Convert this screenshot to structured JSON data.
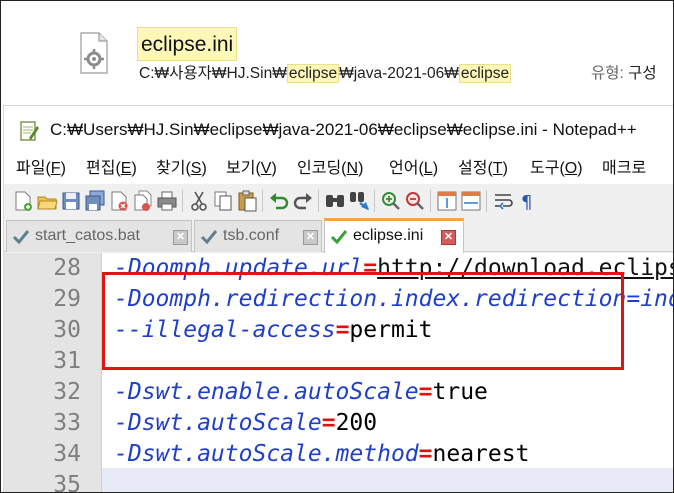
{
  "search_result": {
    "file_name": "eclipse.ini",
    "path_parts": [
      {
        "text": "C:₩사용자₩HJ.Sin₩",
        "hl": false
      },
      {
        "text": "eclipse",
        "hl": true
      },
      {
        "text": "₩java-2021-06₩",
        "hl": false
      },
      {
        "text": "eclipse",
        "hl": true
      }
    ],
    "type_label": "유형:",
    "type_value": "구성"
  },
  "window": {
    "title": "C:₩Users₩HJ.Sin₩eclipse₩java-2021-06₩eclipse₩eclipse.ini - Notepad++"
  },
  "menu": [
    {
      "label": "파일(",
      "key": "F",
      "tail": ")"
    },
    {
      "label": "편집(",
      "key": "E",
      "tail": ")"
    },
    {
      "label": "찾기(",
      "key": "S",
      "tail": ")"
    },
    {
      "label": "보기(",
      "key": "V",
      "tail": ")"
    },
    {
      "label": "인코딩(",
      "key": "N",
      "tail": ")"
    },
    {
      "label": "언어(",
      "key": "L",
      "tail": ")"
    },
    {
      "label": "설정(",
      "key": "T",
      "tail": ")"
    },
    {
      "label": "도구(",
      "key": "O",
      "tail": ")"
    },
    {
      "label": "매크로",
      "key": "",
      "tail": ""
    }
  ],
  "toolbar": {
    "icons": [
      "new-file-icon",
      "open-file-icon",
      "save-icon",
      "save-all-icon",
      "close-icon",
      "close-all-icon",
      "print-icon",
      "cut-icon",
      "copy-icon",
      "paste-icon",
      "undo-icon",
      "redo-icon",
      "find-icon",
      "replace-icon",
      "zoom-in-icon",
      "zoom-out-icon",
      "sync-vertical-icon",
      "sync-horizontal-icon",
      "word-wrap-icon",
      "show-all-chars-icon"
    ]
  },
  "tabs": [
    {
      "label": "start_catos.bat",
      "close": "✕",
      "active": false
    },
    {
      "label": "tsb.conf",
      "close": "✕",
      "active": false
    },
    {
      "label": "eclipse.ini",
      "close": "✕",
      "active": true
    }
  ],
  "editor": {
    "lines": [
      {
        "no": "28",
        "key": "-Doomph.update.url",
        "eq": "=",
        "val": "http://download.eclipse.org/oomph/updates/milestone/latest",
        "url": true
      },
      {
        "no": "29",
        "key": "-Doomph.redirection.index.redirection=index:/->http://git.eclipse.org/c/oomph/org.eclipse.oomph.git/plain/setups/",
        "eq": "",
        "val": "",
        "url": false
      },
      {
        "no": "30",
        "key": "--illegal-access",
        "eq": "=",
        "val": "permit",
        "url": false
      },
      {
        "no": "31",
        "key": "",
        "eq": "",
        "val": "",
        "url": false
      },
      {
        "no": "32",
        "key": "-Dswt.enable.autoScale",
        "eq": "=",
        "val": "true",
        "url": false
      },
      {
        "no": "33",
        "key": "-Dswt.autoScale",
        "eq": "=",
        "val": "200",
        "url": false
      },
      {
        "no": "34",
        "key": "-Dswt.autoScale.method",
        "eq": "=",
        "val": "nearest",
        "url": false
      },
      {
        "no": "35",
        "key": "",
        "eq": "",
        "val": "",
        "url": false
      }
    ]
  },
  "colors": {
    "key": "#1f3fc8",
    "operator": "#e01010",
    "highlight_box": "#e01414",
    "search_highlight": "#fdf8b8",
    "active_tab_accent": "#f6a53a"
  }
}
